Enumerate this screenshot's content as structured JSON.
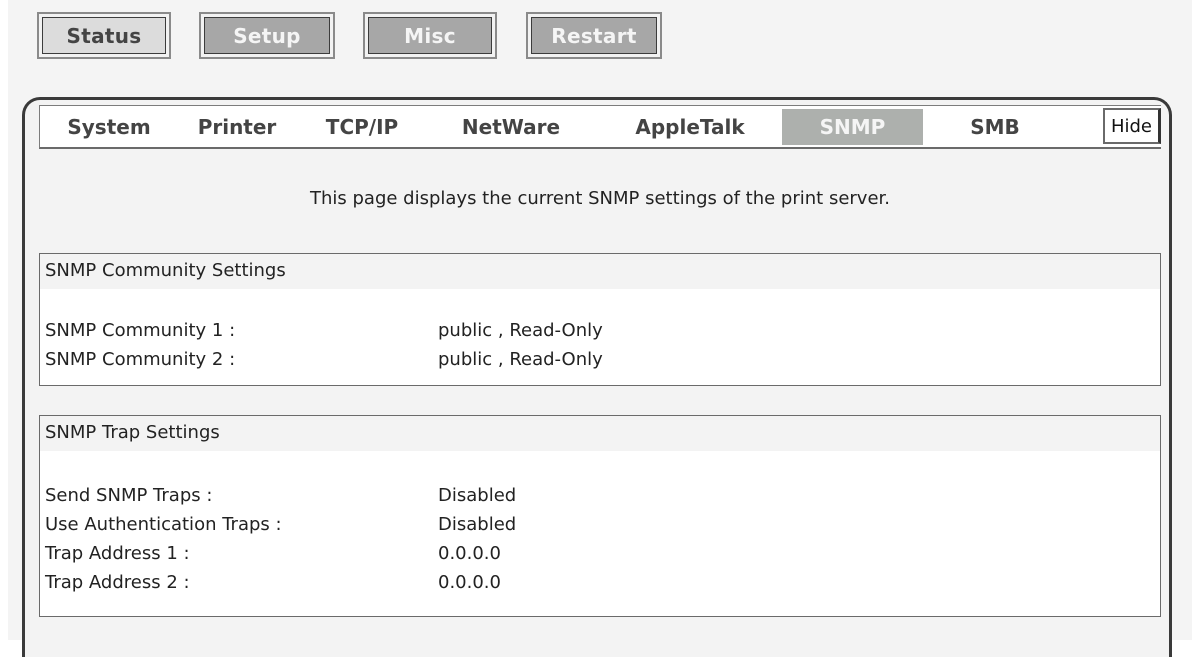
{
  "top_nav": {
    "status": "Status",
    "setup": "Setup",
    "misc": "Misc",
    "restart": "Restart"
  },
  "tabs": {
    "system": "System",
    "printer": "Printer",
    "tcpip": "TCP/IP",
    "netware": "NetWare",
    "appletalk": "AppleTalk",
    "snmp": "SNMP",
    "smb": "SMB",
    "hide": "Hide"
  },
  "intro": "This page displays the current SNMP settings of the print server.",
  "community": {
    "header": "SNMP Community Settings",
    "rows": [
      {
        "label": "SNMP Community 1 :",
        "value": "public , Read-Only"
      },
      {
        "label": "SNMP Community 2 :",
        "value": "public , Read-Only"
      }
    ]
  },
  "trap": {
    "header": "SNMP Trap Settings",
    "rows": [
      {
        "label": "Send SNMP Traps :",
        "value": "Disabled"
      },
      {
        "label": "Use Authentication Traps :",
        "value": "Disabled"
      },
      {
        "label": "Trap Address 1 :",
        "value": "0.0.0.0"
      },
      {
        "label": "Trap Address 2 :",
        "value": "0.0.0.0"
      }
    ]
  }
}
